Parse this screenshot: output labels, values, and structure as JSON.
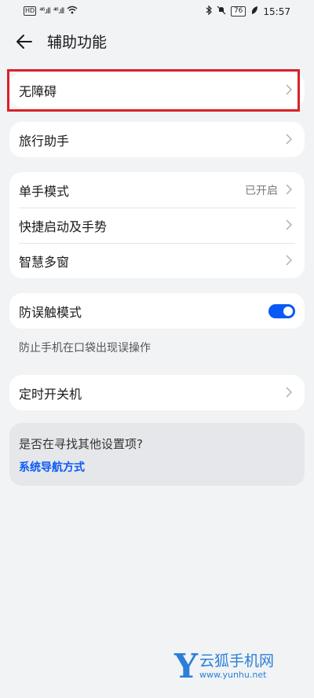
{
  "status_bar": {
    "hd_badge": "HD",
    "signal_1": "⁴⁶.ıll",
    "signal_2": "⁴⁶.ıll",
    "battery": "76",
    "time": "15:57"
  },
  "header": {
    "title": "辅助功能"
  },
  "groups": {
    "accessibility": {
      "label": "无障碍"
    },
    "travel": {
      "label": "旅行助手"
    },
    "one_hand": {
      "label": "单手模式",
      "value": "已开启"
    },
    "shortcut": {
      "label": "快捷启动及手势"
    },
    "smart_window": {
      "label": "智慧多窗"
    },
    "pocket": {
      "label": "防误触模式",
      "enabled": true,
      "description": "防止手机在口袋出现误操作"
    },
    "timer": {
      "label": "定时开关机"
    }
  },
  "tip": {
    "question": "是否在寻找其他设置项?",
    "link": "系统导航方式"
  },
  "watermark": {
    "logo_letter": "Y",
    "name": "云狐手机网",
    "url": "www.yunhu.net"
  },
  "colors": {
    "accent": "#0a59f7",
    "highlight": "#d8222a",
    "watermark": "#2b7fd8"
  }
}
